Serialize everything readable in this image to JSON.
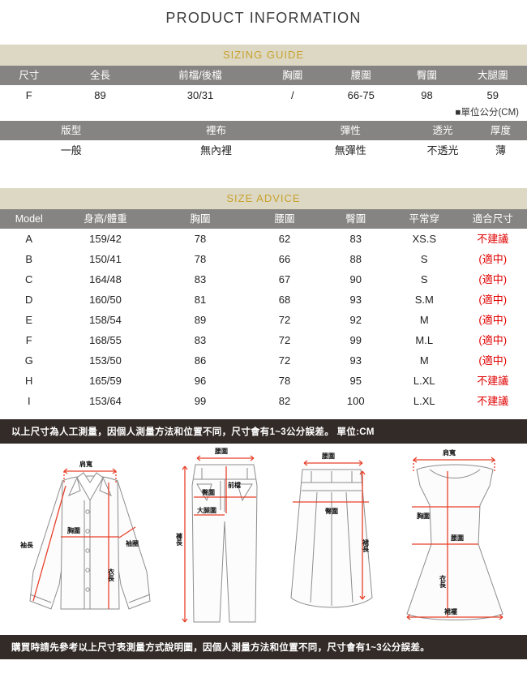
{
  "header": {
    "title": "PRODUCT INFORMATION"
  },
  "sizing_guide": {
    "band_label": "SIZING GUIDE",
    "headers": [
      "尺寸",
      "全長",
      "前檔/後檔",
      "胸圍",
      "腰圍",
      "臀圍",
      "大腿圍"
    ],
    "rows": [
      [
        "F",
        "89",
        "30/31",
        "/",
        "66-75",
        "98",
        "59"
      ]
    ],
    "unit_note": "■單位公分(CM)"
  },
  "fabric_table": {
    "headers": [
      "版型",
      "裡布",
      "彈性",
      "透光",
      "厚度"
    ],
    "rows": [
      [
        "一般",
        "無內裡",
        "無彈性",
        "不透光",
        "薄"
      ]
    ]
  },
  "size_advice": {
    "band_label": "SIZE ADVICE",
    "headers": [
      "Model",
      "身高/體重",
      "胸圍",
      "腰圍",
      "臀圍",
      "平常穿",
      "適合尺寸"
    ],
    "rows": [
      {
        "model": "A",
        "height_weight": "159/42",
        "bust": "78",
        "waist": "62",
        "hip": "83",
        "usual": "XS.S",
        "fit": "不建議"
      },
      {
        "model": "B",
        "height_weight": "150/41",
        "bust": "78",
        "waist": "66",
        "hip": "88",
        "usual": "S",
        "fit": "(適中)"
      },
      {
        "model": "C",
        "height_weight": "164/48",
        "bust": "83",
        "waist": "67",
        "hip": "90",
        "usual": "S",
        "fit": "(適中)"
      },
      {
        "model": "D",
        "height_weight": "160/50",
        "bust": "81",
        "waist": "68",
        "hip": "93",
        "usual": "S.M",
        "fit": "(適中)"
      },
      {
        "model": "E",
        "height_weight": "158/54",
        "bust": "89",
        "waist": "72",
        "hip": "92",
        "usual": "M",
        "fit": "(適中)"
      },
      {
        "model": "F",
        "height_weight": "168/55",
        "bust": "83",
        "waist": "72",
        "hip": "99",
        "usual": "M.L",
        "fit": "(適中)"
      },
      {
        "model": "G",
        "height_weight": "153/50",
        "bust": "86",
        "waist": "72",
        "hip": "93",
        "usual": "M",
        "fit": "(適中)"
      },
      {
        "model": "H",
        "height_weight": "165/59",
        "bust": "96",
        "waist": "78",
        "hip": "95",
        "usual": "L.XL",
        "fit": "不建議"
      },
      {
        "model": "I",
        "height_weight": "153/64",
        "bust": "99",
        "waist": "82",
        "hip": "100",
        "usual": "L.XL",
        "fit": "不建議"
      }
    ],
    "fit_color": "#e00000"
  },
  "notes": {
    "top": "以上尺寸為人工測量，因個人測量方法和位置不同，尺寸會有1~3公分誤差。 單位:CM",
    "bottom": "購買時請先參考以上尺寸表測量方式說明圖，因個人測量方法和位置不同，尺寸會有1~3公分誤差。"
  },
  "diagrams": {
    "shirt": {
      "name": "shirt-measurement-diagram",
      "labels": {
        "shoulder": "肩寬",
        "sleeve_length": "袖長",
        "bust": "胸圍",
        "armhole": "袖圈",
        "body_length": "衣長"
      }
    },
    "pants": {
      "name": "pants-measurement-diagram",
      "labels": {
        "waist": "腰圍",
        "front_rise": "前檔",
        "hip": "臀圍",
        "thigh": "大腿圍",
        "pant_length": "褲長"
      }
    },
    "skirt": {
      "name": "skirt-measurement-diagram",
      "labels": {
        "waist": "腰圍",
        "hip": "臀圍",
        "skirt_length": "裙長"
      }
    },
    "dress": {
      "name": "dress-measurement-diagram",
      "labels": {
        "shoulder": "肩寬",
        "bust": "胸圍",
        "waist": "腰圍",
        "body_length": "衣長",
        "hem": "裙襬"
      }
    }
  },
  "colors": {
    "band_bg": "#ddd8c4",
    "band_text": "#c8a22c",
    "table_header_bg": "#868482",
    "note_bg": "#332b27",
    "measure_line": "#e8402a"
  }
}
